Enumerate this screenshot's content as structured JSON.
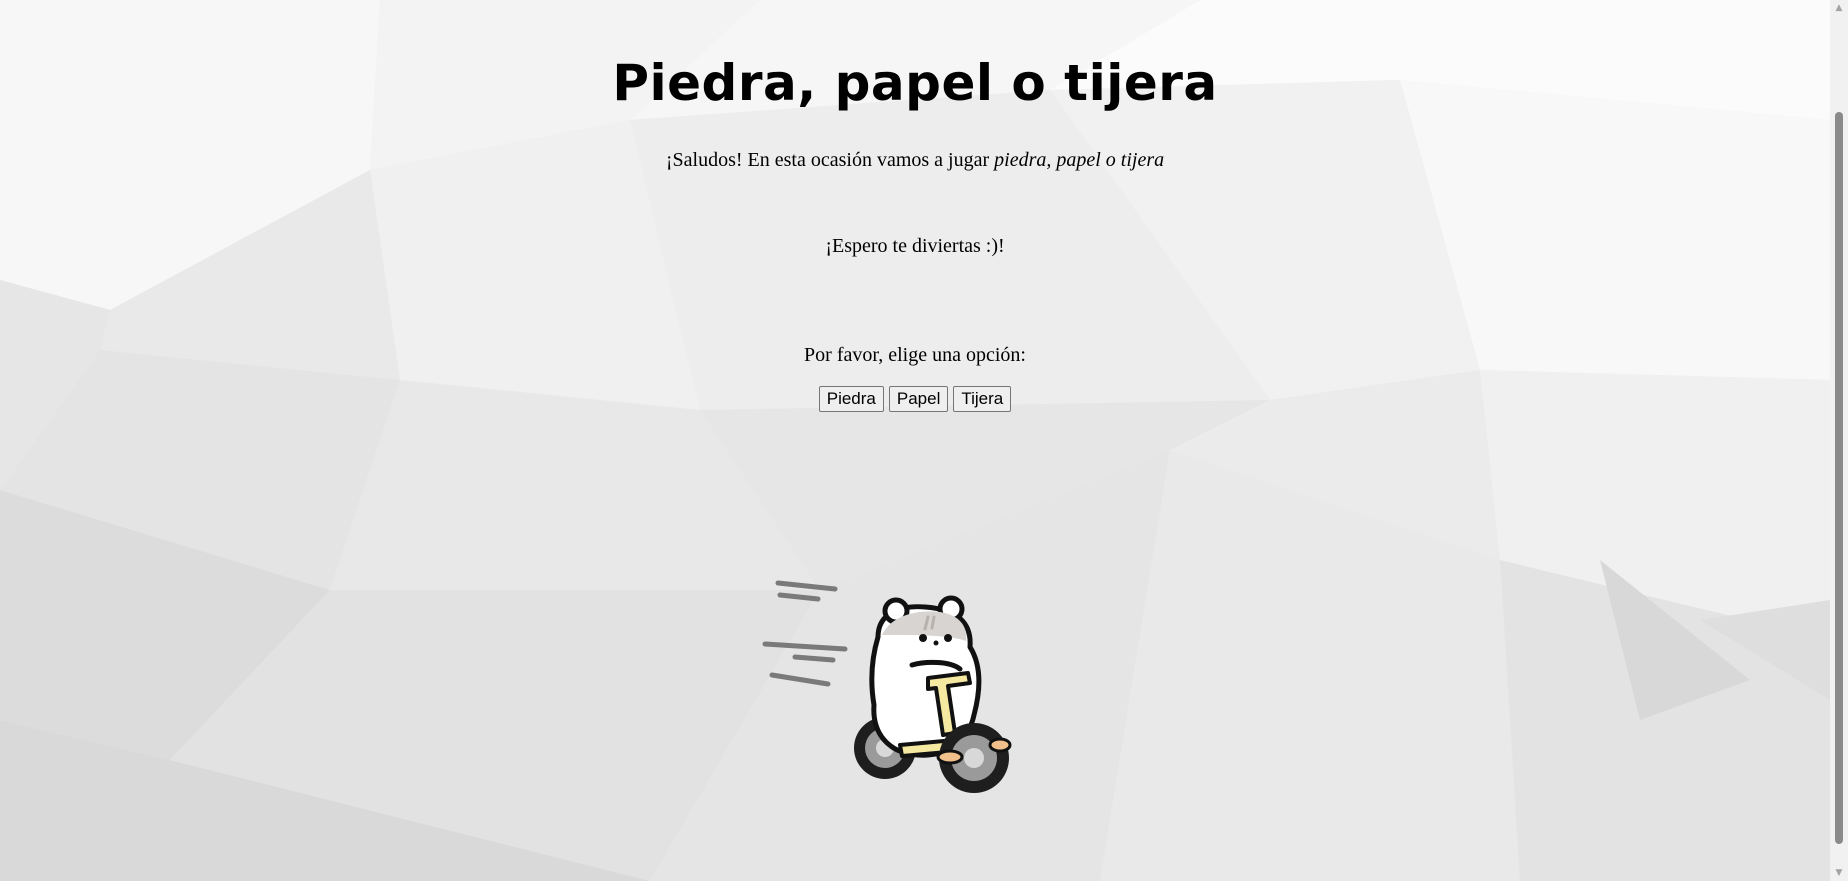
{
  "page": {
    "title": "Piedra, papel o tijera",
    "intro_text": "¡Saludos! En esta ocasión vamos a jugar ",
    "intro_emphasis": "piedra, papel o tijera",
    "wish": "¡Espero te diviertas :)!",
    "prompt": "Por favor, elige una opción:"
  },
  "buttons": {
    "rock": "Piedra",
    "paper": "Papel",
    "scissors": "Tijera"
  },
  "illustration": {
    "subject": "hamster-riding-tricycle",
    "accent_color": "#f5e8a0"
  },
  "scrollbar": {
    "up_icon": "▲",
    "down_icon": "▼"
  }
}
